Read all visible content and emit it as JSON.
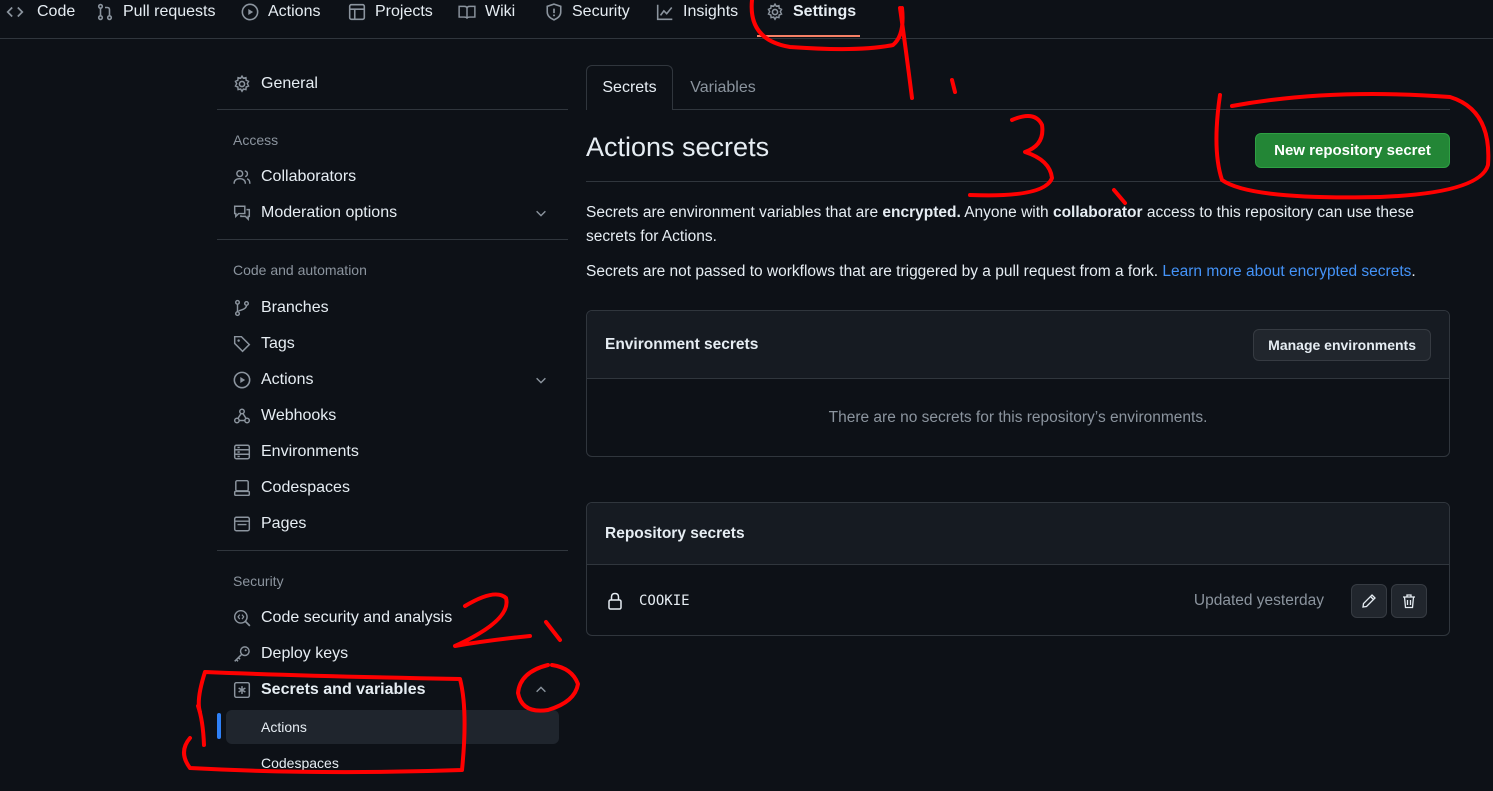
{
  "repo_nav": {
    "tabs": [
      {
        "label": "Code",
        "icon": "code-icon"
      },
      {
        "label": "Pull requests",
        "icon": "pull-request-icon"
      },
      {
        "label": "Actions",
        "icon": "play-icon"
      },
      {
        "label": "Projects",
        "icon": "table-icon"
      },
      {
        "label": "Wiki",
        "icon": "book-icon"
      },
      {
        "label": "Security",
        "icon": "shield-icon"
      },
      {
        "label": "Insights",
        "icon": "graph-icon"
      },
      {
        "label": "Settings",
        "icon": "gear-icon"
      }
    ],
    "active": "Settings"
  },
  "sidebar": {
    "general": "General",
    "access_heading": "Access",
    "access_items": [
      "Collaborators",
      "Moderation options"
    ],
    "code_heading": "Code and automation",
    "code_items": [
      "Branches",
      "Tags",
      "Actions",
      "Webhooks",
      "Environments",
      "Codespaces",
      "Pages"
    ],
    "security_heading": "Security",
    "security_items": [
      "Code security and analysis",
      "Deploy keys",
      "Secrets and variables"
    ],
    "secrets_subitems": [
      "Actions",
      "Codespaces"
    ],
    "active_subitem": "Actions"
  },
  "main": {
    "tabs": [
      "Secrets",
      "Variables"
    ],
    "active_tab": "Secrets",
    "title": "Actions secrets",
    "new_secret_button": "New repository secret",
    "desc1": {
      "p1": "Secrets are environment variables that are ",
      "b1": "encrypted.",
      "p2": " Anyone with ",
      "b2": "collaborator",
      "p3": " access to this repository can use these secrets for Actions."
    },
    "desc2": {
      "text": "Secrets are not passed to workflows that are triggered by a pull request from a fork. ",
      "link": "Learn more about encrypted secrets",
      "end": "."
    },
    "env_secrets": {
      "title": "Environment secrets",
      "button": "Manage environments",
      "empty": "There are no secrets for this repository’s environments."
    },
    "repo_secrets": {
      "title": "Repository secrets",
      "rows": [
        {
          "name": "COOKIE",
          "updated": "Updated yesterday"
        }
      ]
    }
  },
  "annotations": {
    "color": "#ff0000",
    "labels": [
      "1.",
      "2.",
      "3."
    ]
  },
  "colors": {
    "background": "#0d1117",
    "accent_underline": "#f78166",
    "green_button": "#238636",
    "link": "#4493f8",
    "active_bar": "#2f81f7"
  }
}
